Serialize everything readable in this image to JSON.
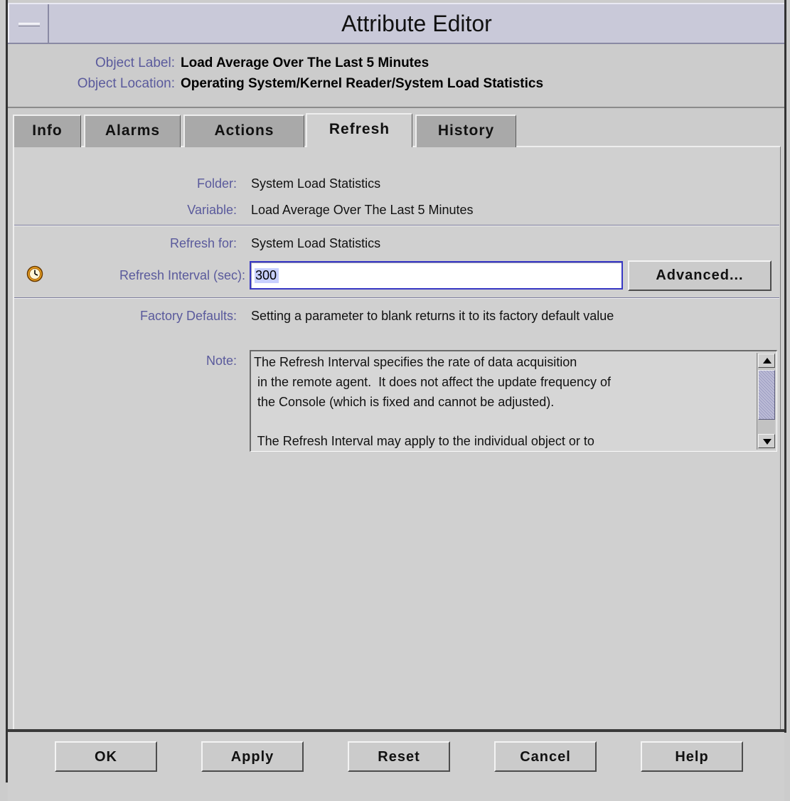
{
  "window": {
    "title": "Attribute Editor"
  },
  "object": {
    "label_key": "Object Label:",
    "label_value": "Load Average Over The Last 5 Minutes",
    "location_key": "Object Location:",
    "location_value": "Operating System/Kernel Reader/System Load Statistics"
  },
  "tabs": [
    {
      "label": "Info"
    },
    {
      "label": "Alarms"
    },
    {
      "label": "Actions"
    },
    {
      "label": "Refresh"
    },
    {
      "label": "History"
    }
  ],
  "active_tab": "Refresh",
  "refresh": {
    "folder_label": "Folder:",
    "folder_value": "System Load Statistics",
    "variable_label": "Variable:",
    "variable_value": "Load Average Over The Last 5 Minutes",
    "refresh_for_label": "Refresh for:",
    "refresh_for_value": "System Load Statistics",
    "interval_label": "Refresh Interval (sec):",
    "interval_value": "300",
    "advanced_label": "Advanced...",
    "defaults_label": "Factory Defaults:",
    "defaults_value": "Setting a parameter to blank returns it to its factory default value",
    "note_label": "Note:",
    "note_lines": [
      "The Refresh Interval specifies the rate of data acquisition",
      " in the remote agent.  It does not affect the update frequency of",
      " the Console (which is fixed and cannot be adjusted).",
      "",
      " The Refresh Interval may apply to the individual object or to"
    ]
  },
  "footer": {
    "ok": "OK",
    "apply": "Apply",
    "reset": "Reset",
    "cancel": "Cancel",
    "help": "Help"
  },
  "icons": {
    "window_menu": "window-menu-icon",
    "clock": "clock-icon",
    "scroll_up": "arrow-up-icon",
    "scroll_down": "arrow-down-icon"
  },
  "colors": {
    "label_text": "#5a5a9c",
    "input_focus_border": "#3838c4",
    "selection": "#c8d0ff",
    "scroll_thumb": "#a7a7c9"
  }
}
